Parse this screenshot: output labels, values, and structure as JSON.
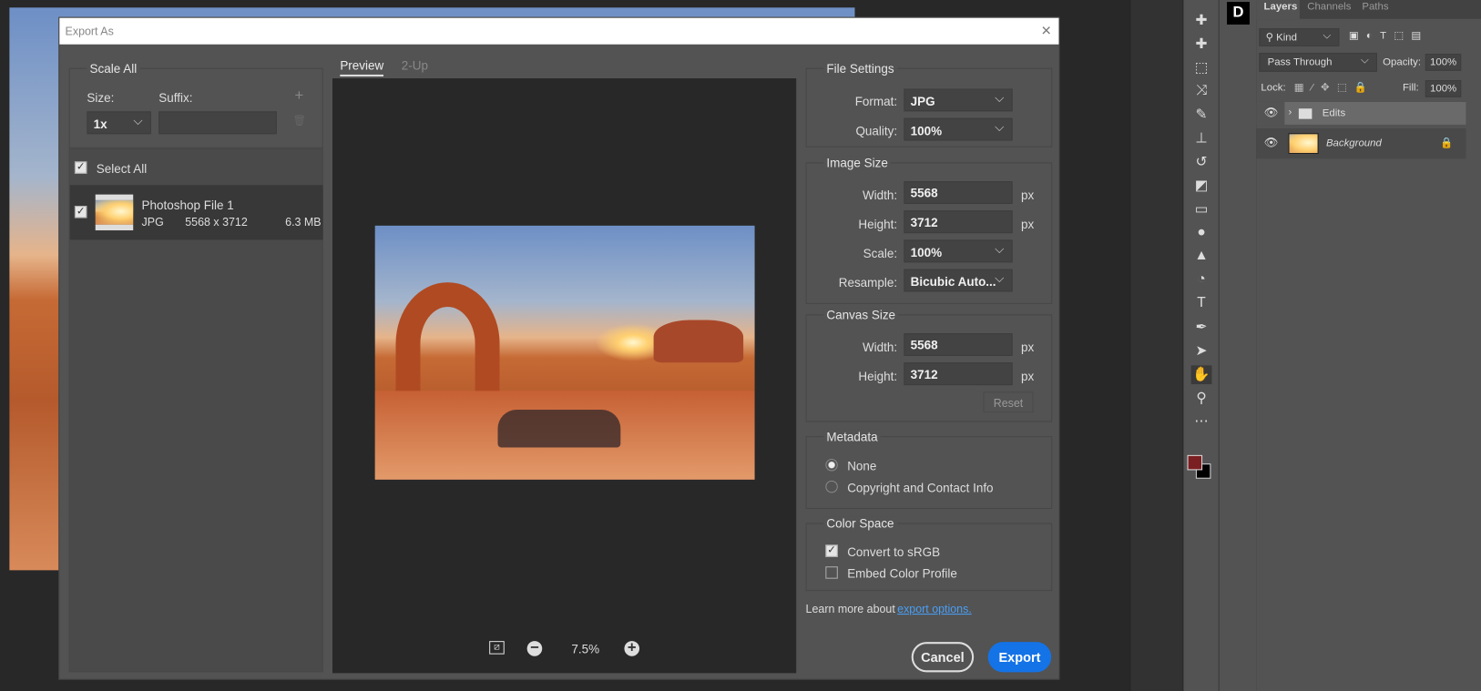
{
  "dialog": {
    "title": "Export As",
    "close": "×"
  },
  "scale_all": {
    "title": "Scale All",
    "size_label": "Size:",
    "suffix_label": "Suffix:",
    "size_value": "1x",
    "suffix_value": "",
    "add": "+",
    "delete": "🗑"
  },
  "files": {
    "select_all": "Select All",
    "items": [
      {
        "name": "Photoshop File 1",
        "format": "JPG",
        "dims": "5568 x 3712",
        "size": "6.3 MB",
        "checked": true
      }
    ]
  },
  "preview": {
    "tabs": [
      "Preview",
      "2-Up"
    ],
    "active_tab": "Preview",
    "zoom": "7.5%"
  },
  "file_settings": {
    "title": "File Settings",
    "format_label": "Format:",
    "format": "JPG",
    "quality_label": "Quality:",
    "quality": "100%"
  },
  "image_size": {
    "title": "Image Size",
    "width_label": "Width:",
    "width": "5568",
    "height_label": "Height:",
    "height": "3712",
    "unit": "px",
    "scale_label": "Scale:",
    "scale": "100%",
    "resample_label": "Resample:",
    "resample": "Bicubic Auto..."
  },
  "canvas_size": {
    "title": "Canvas Size",
    "width_label": "Width:",
    "width": "5568",
    "height_label": "Height:",
    "height": "3712",
    "unit": "px",
    "reset": "Reset"
  },
  "metadata": {
    "title": "Metadata",
    "options": [
      "None",
      "Copyright and Contact Info"
    ],
    "selected": "None"
  },
  "color_space": {
    "title": "Color Space",
    "convert": "Convert to sRGB",
    "convert_checked": true,
    "embed": "Embed Color Profile",
    "embed_checked": false
  },
  "footer": {
    "learn_more": "Learn more about",
    "link": "export options.",
    "cancel": "Cancel",
    "export": "Export"
  },
  "colors": {
    "accent": "#1473e6",
    "foreground": "#7a1f22",
    "background": "#000000"
  },
  "layers_panel": {
    "tabs": [
      "Layers",
      "Channels",
      "Paths"
    ],
    "active_tab": "Layers",
    "filter": "Kind",
    "blend_mode": "Pass Through",
    "opacity_label": "Opacity:",
    "opacity": "100%",
    "lock_label": "Lock:",
    "fill_label": "Fill:",
    "fill": "100%",
    "layers": [
      {
        "name": "Edits",
        "type": "group"
      },
      {
        "name": "Background",
        "type": "image",
        "locked": true
      }
    ]
  },
  "toolbar": {
    "tools": [
      "healing-brush",
      "patch",
      "marquee",
      "crop-swap",
      "brush",
      "stamp",
      "history-brush",
      "eraser",
      "gradient",
      "blur",
      "sharpen",
      "dodge",
      "type",
      "pen",
      "path-select",
      "hand",
      "zoom",
      "more"
    ]
  }
}
